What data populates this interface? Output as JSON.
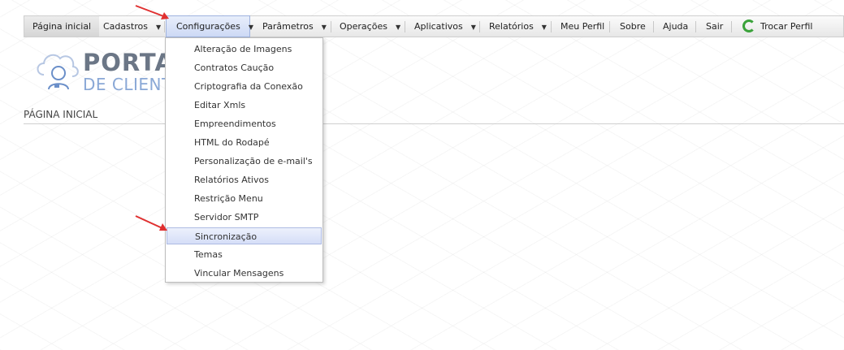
{
  "menu": {
    "home": "Página inicial",
    "cadastros": "Cadastros",
    "configuracoes": "Configurações",
    "parametros": "Parâmetros",
    "operacoes": "Operações",
    "aplicativos": "Aplicativos",
    "relatorios": "Relatórios",
    "meu_perfil": "Meu Perfil",
    "sobre": "Sobre",
    "ajuda": "Ajuda",
    "sair": "Sair",
    "trocar_perfil": "Trocar Perfil"
  },
  "logo": {
    "line1": "PORTA",
    "line2": "DE CLIENT"
  },
  "page_title": "PÁGINA INICIAL",
  "dropdown": {
    "items": [
      "Alteração de Imagens",
      "Contratos Caução",
      "Criptografia da Conexão",
      "Editar Xmls",
      "Empreendimentos",
      "HTML do Rodapé",
      "Personalização de e-mail's",
      "Relatórios Ativos",
      "Restrição Menu",
      "Servidor SMTP",
      "Sincronização",
      "Temas",
      "Vincular Mensagens"
    ],
    "highlighted": "Sincronização"
  },
  "colors": {
    "accent_arrow": "#e03030",
    "sync_icon": "#3aa23a",
    "logo_text": "#6b7686",
    "logo_sub": "#8aa8d6"
  }
}
